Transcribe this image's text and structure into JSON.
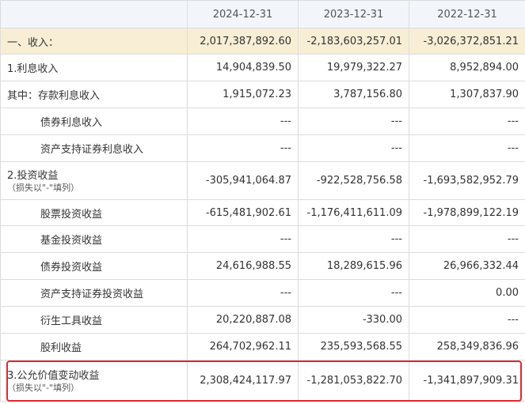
{
  "header": {
    "col0": "",
    "col1": "2024-12-31",
    "col2": "2023-12-31",
    "col3": "2022-12-31"
  },
  "rows": [
    {
      "label": "一、收入：",
      "v1": "2,017,387,892.60",
      "v2": "-2,183,603,257.01",
      "v3": "-3,026,372,851.21"
    },
    {
      "label": "1.利息收入",
      "v1": "14,904,839.50",
      "v2": "19,979,322.27",
      "v3": "8,952,894.00"
    },
    {
      "label": "其中：存款利息收入",
      "v1": "1,915,072.23",
      "v2": "3,787,156.80",
      "v3": "1,307,837.90"
    },
    {
      "label": "债券利息收入",
      "v1": "---",
      "v2": "---",
      "v3": "---"
    },
    {
      "label": "资产支持证券利息收入",
      "v1": "---",
      "v2": "---",
      "v3": "---"
    },
    {
      "label": "2.投资收益",
      "note": "（损失以\"-\"填列）",
      "v1": "-305,941,064.87",
      "v2": "-922,528,756.58",
      "v3": "-1,693,582,952.79"
    },
    {
      "label": "股票投资收益",
      "v1": "-615,481,902.61",
      "v2": "-1,176,411,611.09",
      "v3": "-1,978,899,122.19"
    },
    {
      "label": "基金投资收益",
      "v1": "---",
      "v2": "---",
      "v3": "---"
    },
    {
      "label": "债券投资收益",
      "v1": "24,616,988.55",
      "v2": "18,289,615.96",
      "v3": "26,966,332.44"
    },
    {
      "label": "资产支持证券投资收益",
      "v1": "---",
      "v2": "---",
      "v3": "0.00"
    },
    {
      "label": "衍生工具收益",
      "v1": "20,220,887.08",
      "v2": "-330.00",
      "v3": "---"
    },
    {
      "label": "股利收益",
      "v1": "264,702,962.11",
      "v2": "235,593,568.55",
      "v3": "258,349,836.96"
    },
    {
      "label": "3.公允价值变动收益",
      "note": "（损失以\"-\"填列）",
      "v1": "2,308,424,117.97",
      "v2": "-1,281,053,822.70",
      "v3": "-1,341,897,909.31"
    }
  ]
}
